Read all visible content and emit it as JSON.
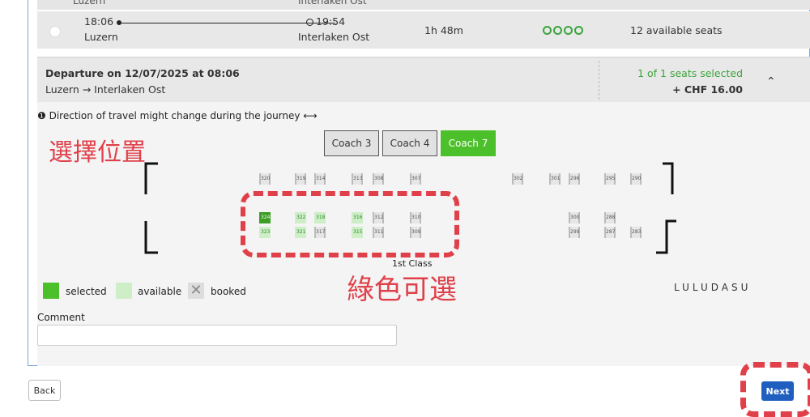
{
  "prev_row": {
    "from": "Luzern",
    "to": "Interlaken Ost"
  },
  "connection": {
    "dep_time": "18:06",
    "from": "Luzern",
    "arr_time": "19:54",
    "to": "Interlaken Ost",
    "duration": "1h 48m",
    "seats": "12 available seats"
  },
  "panel": {
    "title": "Departure on 12/07/2025 at 08:06",
    "route": "Luzern → Interlaken Ost",
    "selected": "1 of 1 seats selected",
    "price": "+ CHF 16.00"
  },
  "direction_note": "Direction of travel might change during the journey",
  "annotation_select": "選擇位置",
  "annotation_green": "綠色可選",
  "watermark": "LULUDASU",
  "coaches": [
    "Coach 3",
    "Coach 4",
    "Coach 7"
  ],
  "class_label": "1st Class",
  "seats": {
    "top": [
      "320",
      "319",
      "314",
      "313",
      "308",
      "307",
      "302",
      "301",
      "296",
      "295",
      "290"
    ],
    "mid_a": [
      "324",
      "322",
      "318",
      "316",
      "312",
      "310",
      "300",
      "288"
    ],
    "mid_b": [
      "323",
      "321",
      "317",
      "315",
      "311",
      "309",
      "299",
      "287",
      "283"
    ]
  },
  "legend": {
    "selected": "selected",
    "available": "available",
    "booked": "booked"
  },
  "comment_label": "Comment",
  "buttons": {
    "back": "Back",
    "next": "Next"
  },
  "colors": {
    "accent": "#4cc02a",
    "annotation": "#e0404a",
    "primary": "#1f5fbf"
  }
}
